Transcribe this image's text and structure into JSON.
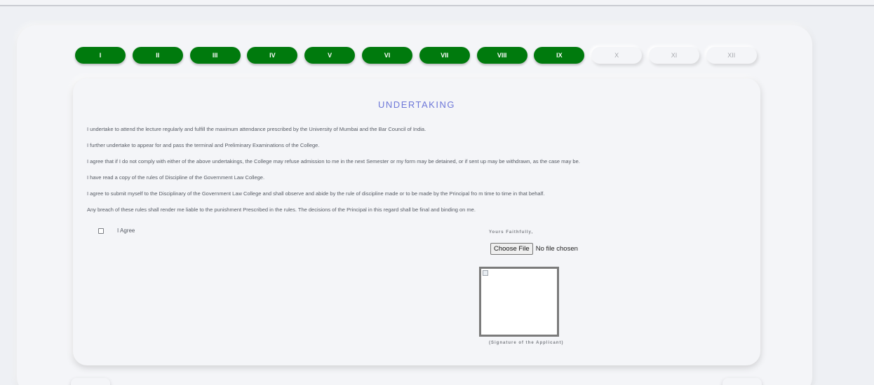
{
  "steps": [
    {
      "label": "I",
      "active": true
    },
    {
      "label": "II",
      "active": true
    },
    {
      "label": "III",
      "active": true
    },
    {
      "label": "IV",
      "active": true
    },
    {
      "label": "V",
      "active": true
    },
    {
      "label": "VI",
      "active": true
    },
    {
      "label": "VII",
      "active": true
    },
    {
      "label": "VIII",
      "active": true
    },
    {
      "label": "IX",
      "active": true
    },
    {
      "label": "X",
      "active": false
    },
    {
      "label": "XI",
      "active": false
    },
    {
      "label": "XII",
      "active": false
    }
  ],
  "colors": {
    "active_step": "#007a0d",
    "title": "#6d77d8"
  },
  "undertaking": {
    "title": "UNDERTAKING",
    "lines": [
      "I undertake to attend the lecture regularly and fulfill the maximum attendance prescribed by the University of Mumbai and the Bar Council of India.",
      "I further undertake to appear for and pass the terminal and Preliminary Examinations of the College.",
      "I agree that if I do not comply with either of the above undertakings, the College may refuse admission to me in the next Semester or my form may be detained, or if sent up may be withdrawn, as the case may be.",
      "I have read a copy of the rules of Discipline of the Government Law College.",
      "I agree to submit myself to the Disciplinary of the Government Law College and shall observe and abide by the rule of discipline made or to be made by the Principal fro m time to time in that behalf.",
      "Any breach of these rules shall render me liable to the punishment Prescribed in the rules. The decisions of the Principal in this regard shall be final and binding on me."
    ],
    "agree_label": "I Agree",
    "agree_checked": false
  },
  "signature": {
    "yours": "Yours Faithfully,",
    "choose_file": "Choose File",
    "no_file": "No file chosen",
    "caption": "(Signature of the Applicant)",
    "icon": "broken-image-icon"
  }
}
